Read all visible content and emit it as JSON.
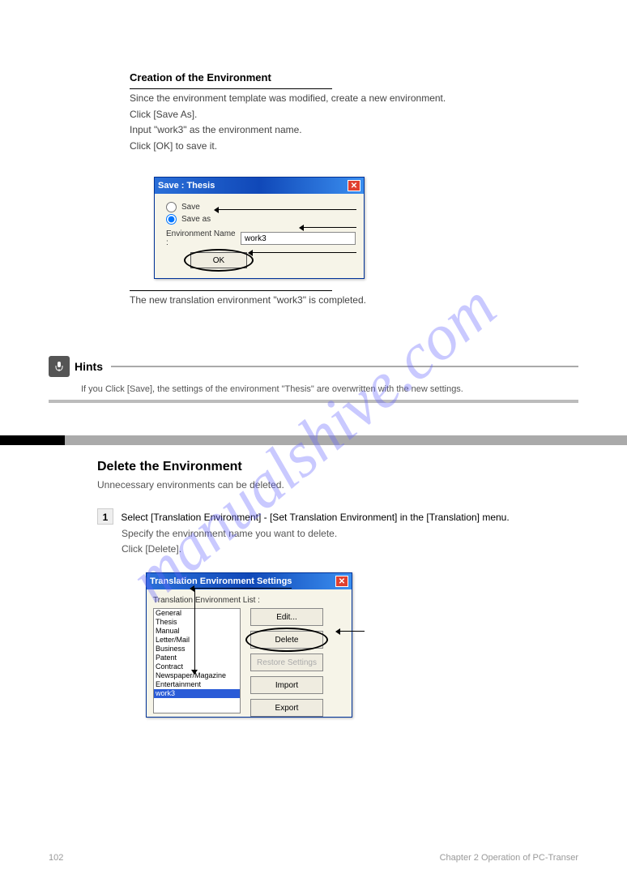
{
  "watermark": "manualshive.com",
  "section1": {
    "title": "Creation of the Environment",
    "line1": "Since the environment template was modified, create a new environment.",
    "line2": "Click [Save As].",
    "line3": "Input \"work3\" as the environment name.",
    "line4": "Click [OK] to save it.",
    "line5": "The new translation environment \"work3\" is completed."
  },
  "dialog1": {
    "title": "Save : Thesis",
    "radio_save": "Save",
    "radio_saveas": "Save as",
    "env_label": "Environment Name :",
    "env_value": "work3",
    "ok_label": "OK"
  },
  "hints": {
    "label": "Hints",
    "text": "If you Click [Save], the settings of the environment \"Thesis\" are overwritten with the new settings."
  },
  "section2": {
    "title": "Delete the Environment",
    "para": "Unnecessary environments can be deleted.",
    "step1_num": "1",
    "step1_text": "Select [Translation Environment] - [Set Translation Environment] in the [Translation] menu.",
    "step2_text": "Specify the environment name you want to delete.",
    "step3_text": "Click [Delete]."
  },
  "dialog2": {
    "title": "Translation Environment Settings",
    "list_label": "Translation Environment List :",
    "items": [
      "General",
      "Thesis",
      "Manual",
      "Letter/Mail",
      "Business",
      "Patent",
      "Contract",
      "Newspaper/Magazine",
      "Entertainment",
      "work3"
    ],
    "selected": "work3",
    "btn_edit": "Edit...",
    "btn_delete": "Delete",
    "btn_restore": "Restore Settings",
    "btn_import": "Import",
    "btn_export": "Export"
  },
  "footer": {
    "page": "102",
    "chapter": "Chapter 2  Operation of PC-Transer"
  }
}
